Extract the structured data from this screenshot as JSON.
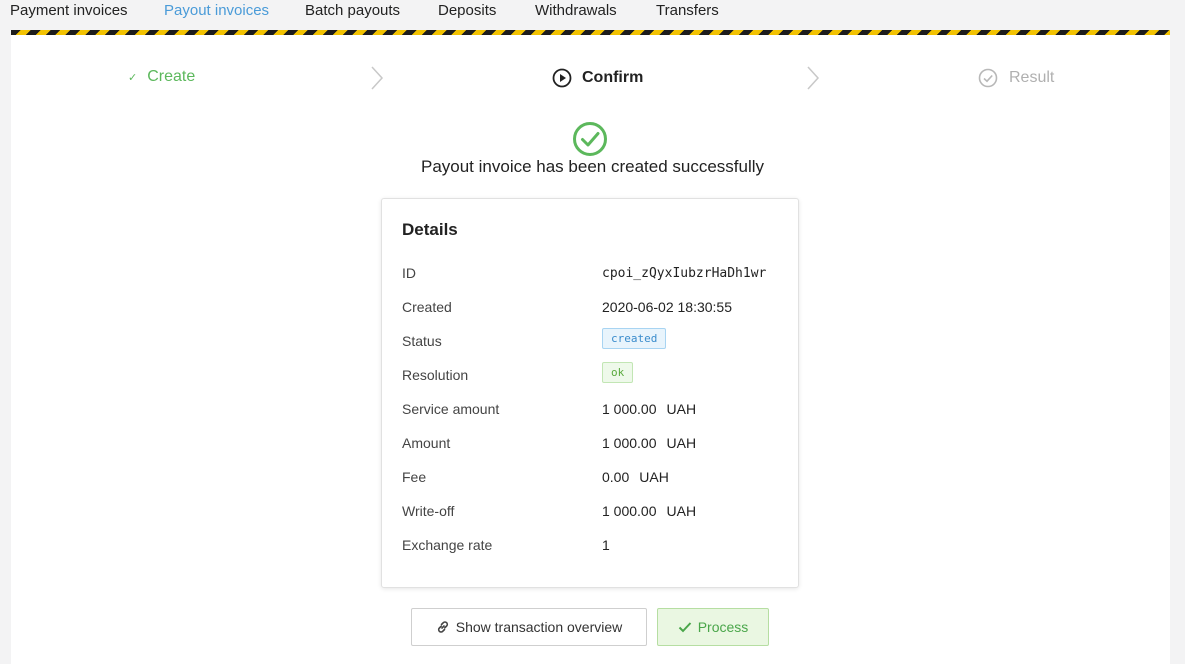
{
  "tabs": [
    {
      "label": "Payment invoices"
    },
    {
      "label": "Payout invoices",
      "active": true
    },
    {
      "label": "Batch payouts"
    },
    {
      "label": "Deposits"
    },
    {
      "label": "Withdrawals"
    },
    {
      "label": "Transfers"
    }
  ],
  "steps": [
    {
      "label": "Create",
      "state": "done"
    },
    {
      "label": "Confirm",
      "state": "current"
    },
    {
      "label": "Result",
      "state": "pending"
    }
  ],
  "success_message": "Payout invoice has been created successfully",
  "details": {
    "title": "Details",
    "rows": [
      {
        "key": "ID",
        "value": "cpoi_zQyxIubzrHaDh1wr"
      },
      {
        "key": "Created",
        "value": "2020-06-02 18:30:55"
      },
      {
        "key": "Status",
        "value": "created"
      },
      {
        "key": "Resolution",
        "value": "ok"
      },
      {
        "key": "Service amount",
        "value": "1 000.00",
        "currency": "UAH"
      },
      {
        "key": "Amount",
        "value": "1 000.00",
        "currency": "UAH"
      },
      {
        "key": "Fee",
        "value": "0.00",
        "currency": "UAH"
      },
      {
        "key": "Write-off",
        "value": "1 000.00",
        "currency": "UAH"
      },
      {
        "key": "Exchange rate",
        "value": "1"
      }
    ]
  },
  "buttons": {
    "overview": "Show transaction overview",
    "process": "Process"
  },
  "colors": {
    "accent_blue": "#4a9bd8",
    "success_green": "#5cb85c",
    "stripe_yellow": "#f2c200",
    "stripe_black": "#1c1c1c"
  }
}
